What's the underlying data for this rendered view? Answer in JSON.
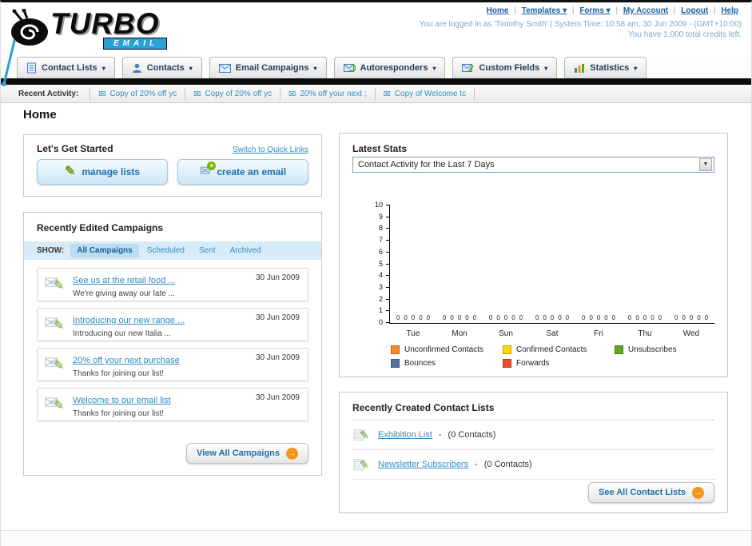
{
  "header": {
    "logo_title": "TURBO",
    "logo_subtitle": "EMAIL",
    "link_separator": "|",
    "nav_links": [
      {
        "label": "Home",
        "dropdown": false
      },
      {
        "label": "Templates",
        "dropdown": true
      },
      {
        "label": "Forms",
        "dropdown": true
      },
      {
        "label": "My Account",
        "dropdown": false
      },
      {
        "label": "Logout",
        "dropdown": false
      },
      {
        "label": "Help",
        "dropdown": false
      }
    ],
    "login_info": "You are logged in as 'Timothy Smith' | System Time: 10:58 am, 30 Jun 2009 - (GMT+10:00)",
    "credits_info": "You have 1,000 total credits left."
  },
  "main_nav": {
    "tabs": [
      {
        "label": "Contact Lists",
        "icon": "contact-lists-icon"
      },
      {
        "label": "Contacts",
        "icon": "contacts-icon"
      },
      {
        "label": "Email Campaigns",
        "icon": "email-campaigns-icon"
      },
      {
        "label": "Autoresponders",
        "icon": "autoresponders-icon"
      },
      {
        "label": "Custom Fields",
        "icon": "custom-fields-icon"
      },
      {
        "label": "Statistics",
        "icon": "statistics-icon"
      }
    ]
  },
  "recent_activity": {
    "label": "Recent Activity:",
    "items": [
      "Copy of 20% off yc",
      "Copy of 20% off yc",
      "20% off your next ;",
      "Copy of Welcome tc"
    ]
  },
  "page_title": "Home",
  "get_started": {
    "title": "Let's Get Started",
    "switch_link": "Switch to Quick Links",
    "manage_lists_button": "manage lists",
    "create_email_button": "create an email"
  },
  "campaigns": {
    "title": "Recently Edited Campaigns",
    "show_label": "SHOW:",
    "filters": [
      "All Campaigns",
      "Scheduled",
      "Sent",
      "Archived"
    ],
    "active_filter": "All Campaigns",
    "items": [
      {
        "title": "See us at the retail food ...",
        "subtitle": "We're giving away our late ...",
        "date": "30 Jun 2009"
      },
      {
        "title": "Introducing our new range ...",
        "subtitle": "Introducing our new Italia ...",
        "date": "30 Jun 2009"
      },
      {
        "title": "20% off your next purchase",
        "subtitle": "Thanks for joining our list!",
        "date": "30 Jun 2009"
      },
      {
        "title": "Welcome to our email list",
        "subtitle": "Thanks for joining our list!",
        "date": "30 Jun 2009"
      }
    ],
    "view_all_button": "View All Campaigns"
  },
  "stats": {
    "title": "Latest Stats",
    "dropdown_value": "Contact Activity for the Last 7 Days",
    "chart_data": {
      "type": "bar",
      "title": "Contact Activity for the Last 7 Days",
      "categories": [
        "Tue",
        "Mon",
        "Sun",
        "Sat",
        "Fri",
        "Thu",
        "Wed"
      ],
      "series": [
        {
          "name": "Unconfirmed Contacts",
          "color": "#F68B1F",
          "values": [
            0,
            0,
            0,
            0,
            0,
            0,
            0
          ]
        },
        {
          "name": "Confirmed Contacts",
          "color": "#FFD400",
          "values": [
            0,
            0,
            0,
            0,
            0,
            0,
            0
          ]
        },
        {
          "name": "Unsubscribes",
          "color": "#61A521",
          "values": [
            0,
            0,
            0,
            0,
            0,
            0,
            0
          ]
        },
        {
          "name": "Bounces",
          "color": "#5572A7",
          "values": [
            0,
            0,
            0,
            0,
            0,
            0,
            0
          ]
        },
        {
          "name": "Forwards",
          "color": "#E8502D",
          "values": [
            0,
            0,
            0,
            0,
            0,
            0,
            0
          ]
        }
      ],
      "ylim": [
        0,
        10
      ],
      "ytick_step": 1,
      "grid": false,
      "legend_position": "bottom",
      "xlabel": "",
      "ylabel": ""
    }
  },
  "contact_lists": {
    "title": "Recently Created Contact Lists",
    "separator": "-",
    "items": [
      {
        "name": "Exhibition List",
        "count": "(0 Contacts)"
      },
      {
        "name": "Newsletter Subscribers",
        "count": "(0 Contacts)"
      }
    ],
    "see_all_button": "See All Contact Lists"
  }
}
